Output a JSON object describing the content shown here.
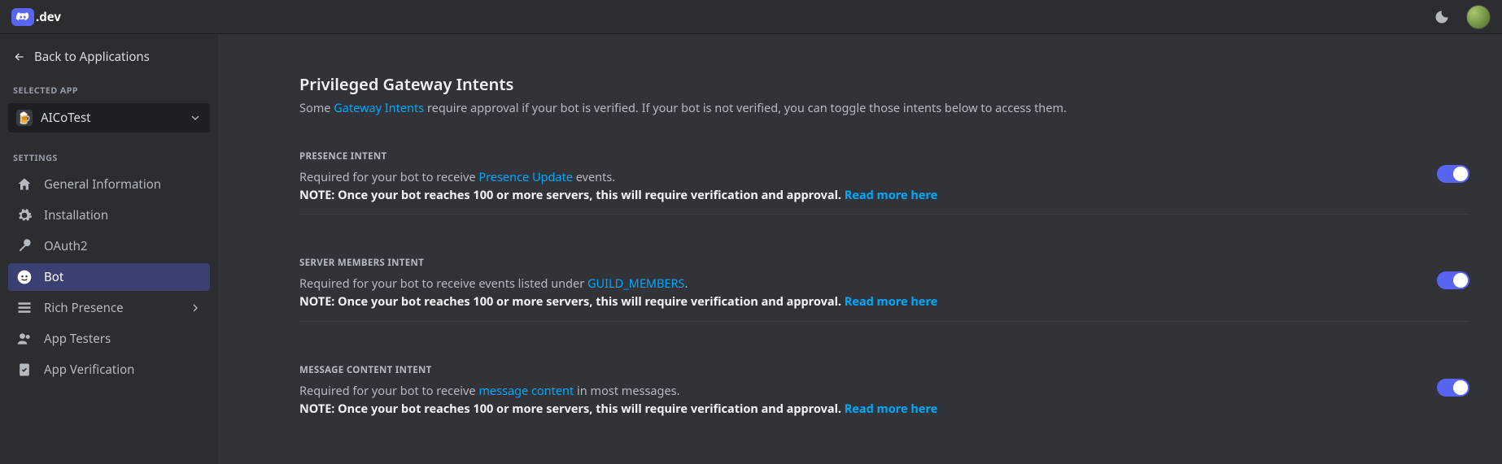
{
  "header": {
    "brand_suffix": ".dev"
  },
  "sidebar": {
    "back_label": "Back to Applications",
    "selected_app_label": "SELECTED APP",
    "app_name": "AICoTest",
    "settings_label": "SETTINGS",
    "items": [
      {
        "label": "General Information"
      },
      {
        "label": "Installation"
      },
      {
        "label": "OAuth2"
      },
      {
        "label": "Bot"
      },
      {
        "label": "Rich Presence"
      },
      {
        "label": "App Testers"
      },
      {
        "label": "App Verification"
      }
    ]
  },
  "main": {
    "title": "Privileged Gateway Intents",
    "desc_prefix": "Some ",
    "desc_link": "Gateway Intents",
    "desc_suffix": " require approval if your bot is verified. If your bot is not verified, you can toggle those intents below to access them.",
    "intents": [
      {
        "label": "PRESENCE INTENT",
        "text_prefix": "Required for your bot to receive ",
        "text_link": "Presence Update",
        "text_suffix": " events.",
        "note_prefix": "NOTE: Once your bot reaches 100 or more servers, this will require verification and approval. ",
        "note_link": "Read more here",
        "enabled": true
      },
      {
        "label": "SERVER MEMBERS INTENT",
        "text_prefix": "Required for your bot to receive events listed under ",
        "text_link": "GUILD_MEMBERS",
        "text_suffix": ".",
        "note_prefix": "NOTE: Once your bot reaches 100 or more servers, this will require verification and approval. ",
        "note_link": "Read more here",
        "enabled": true
      },
      {
        "label": "MESSAGE CONTENT INTENT",
        "text_prefix": "Required for your bot to receive ",
        "text_link": "message content",
        "text_suffix": " in most messages.",
        "note_prefix": "NOTE: Once your bot reaches 100 or more servers, this will require verification and approval. ",
        "note_link": "Read more here",
        "enabled": true
      }
    ]
  }
}
